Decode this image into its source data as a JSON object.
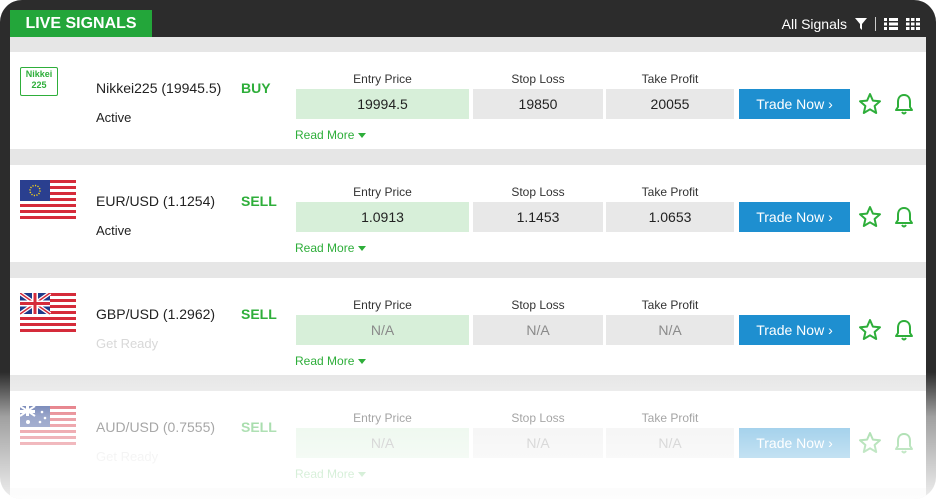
{
  "header": {
    "live_signals": "LIVE SIGNALS",
    "all_signals": "All Signals"
  },
  "columns": {
    "entry_price": "Entry Price",
    "stop_loss": "Stop Loss",
    "take_profit": "Take Profit"
  },
  "actions": {
    "read_more": "Read More",
    "trade_now": "Trade Now ›"
  },
  "signals": [
    {
      "asset": "Nikkei225",
      "name": "Nikkei225 (19945.5)",
      "side": "BUY",
      "status": "Active",
      "entry": "19994.5",
      "stop": "19850",
      "take": "20055",
      "logo_text": "Nikkei 225"
    },
    {
      "asset": "EUR/USD",
      "name": "EUR/USD (1.1254)",
      "side": "SELL",
      "status": "Active",
      "entry": "1.0913",
      "stop": "1.1453",
      "take": "1.0653"
    },
    {
      "asset": "GBP/USD",
      "name": "GBP/USD (1.2962)",
      "side": "SELL",
      "status": "Get Ready",
      "entry": "N/A",
      "stop": "N/A",
      "take": "N/A"
    },
    {
      "asset": "AUD/USD",
      "name": "AUD/USD (0.7555)",
      "side": "SELL",
      "status": "Get Ready",
      "entry": "N/A",
      "stop": "N/A",
      "take": "N/A"
    }
  ],
  "colors": {
    "brand_green": "#23a63a",
    "trade_blue": "#1e8fd0",
    "entry_bg": "#d7efd9"
  }
}
